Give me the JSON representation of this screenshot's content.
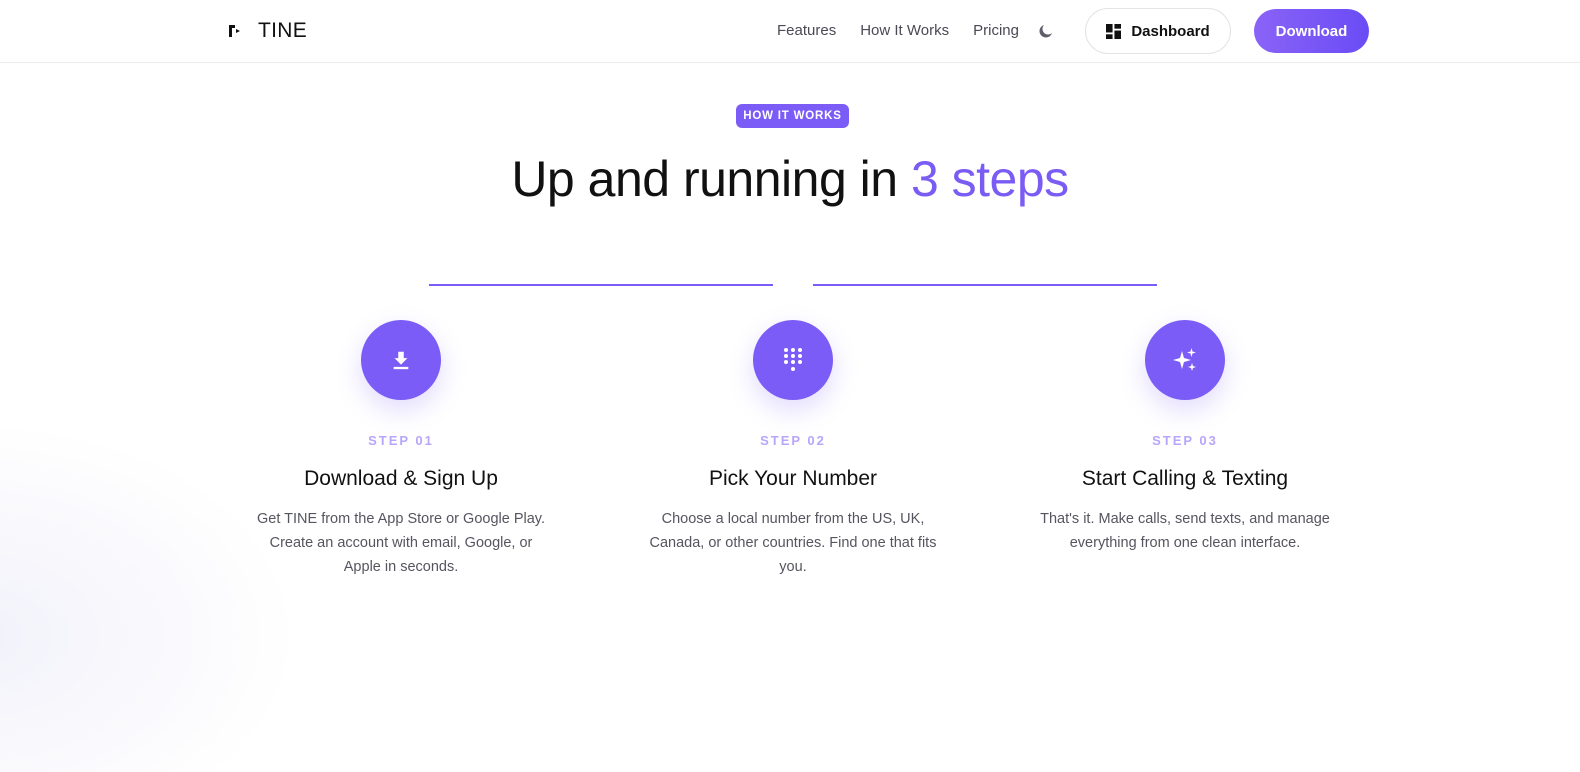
{
  "brand": {
    "name": "TINE"
  },
  "nav": {
    "items": [
      {
        "label": "Features"
      },
      {
        "label": "How It Works"
      },
      {
        "label": "Pricing"
      }
    ],
    "dashboard_label": "Dashboard",
    "download_label": "Download"
  },
  "section": {
    "badge": "HOW IT WORKS",
    "title_plain": "Up and running in ",
    "title_accent": "3 steps",
    "steps": [
      {
        "number": "STEP 01",
        "title": "Download & Sign Up",
        "description": "Get TINE from the App Store or Google Play. Create an account with email, Google, or Apple in seconds.",
        "icon": "download-icon"
      },
      {
        "number": "STEP 02",
        "title": "Pick Your Number",
        "description": "Choose a local number from the US, UK, Canada, or other countries. Find one that fits you.",
        "icon": "dialpad-icon"
      },
      {
        "number": "STEP 03",
        "title": "Start Calling & Texting",
        "description": "That's it. Make calls, send texts, and manage everything from one clean interface.",
        "icon": "sparkles-icon"
      }
    ]
  },
  "colors": {
    "accent": "#7c5cf6",
    "accent_light": "#b8a6fb",
    "text": "#111111",
    "muted": "#55555f"
  }
}
